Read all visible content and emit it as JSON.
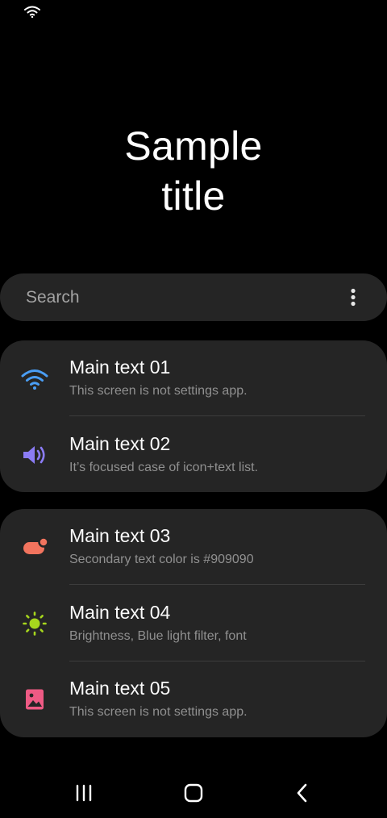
{
  "title": {
    "line1": "Sample",
    "line2": "title"
  },
  "search": {
    "placeholder": "Search"
  },
  "card1": {
    "items": [
      {
        "main": "Main text 01",
        "sub": "This screen is not settings app.",
        "icon": "wifi-icon",
        "icon_color": "#4a9ef5"
      },
      {
        "main": "Main text 02",
        "sub": "It’s focused case of icon+text list.",
        "icon": "speaker-icon",
        "icon_color": "#8b7cf6"
      }
    ]
  },
  "card2": {
    "items": [
      {
        "main": "Main text 03",
        "sub": "Secondary text color is #909090",
        "icon": "toggle-icon",
        "icon_color": "#f2745e"
      },
      {
        "main": "Main text 04",
        "sub": "Brightness, Blue light filter, font",
        "icon": "brightness-icon",
        "icon_color": "#a6d61d"
      },
      {
        "main": "Main text 05",
        "sub": "This screen is not settings app.",
        "icon": "image-icon",
        "icon_color": "#ee5a84"
      }
    ]
  },
  "nav": {
    "recents": "recents-icon",
    "home": "home-icon",
    "back": "back-icon"
  },
  "colors": {
    "background": "#000000",
    "card": "#252525",
    "secondary_text": "#909090"
  }
}
